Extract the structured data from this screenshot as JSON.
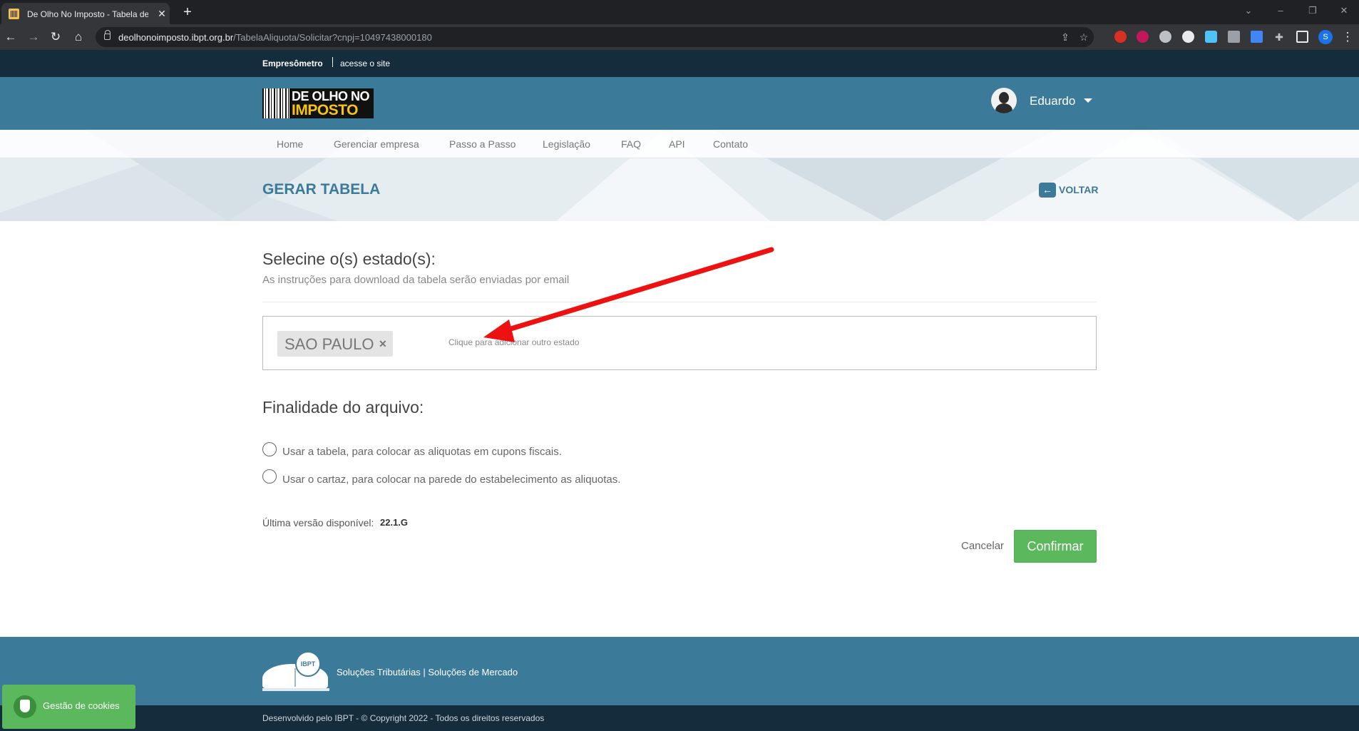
{
  "browser": {
    "tab_title": "De Olho No Imposto - Tabela de",
    "url_host": "deolhonoimposto.ibpt.org.br",
    "url_path": "/TabelaAliquota/Solicitar?cnpj=10497438000180",
    "profile_initial": "S"
  },
  "topstrip": {
    "brand": "Empresômetro",
    "link": "acesse o site"
  },
  "header": {
    "logo_line1": "DE OLHO NO",
    "logo_line2": "IMPOSTO",
    "user_name": "Eduardo"
  },
  "nav": {
    "items": [
      "Home",
      "Gerenciar empresa",
      "Passo a Passo",
      "Legislação",
      "FAQ",
      "API",
      "Contato"
    ]
  },
  "banner": {
    "title": "GERAR TABELA",
    "back_label": "VOLTAR"
  },
  "form": {
    "states_heading": "Selecine o(s) estado(s):",
    "states_subtitle": "As instruções para download da tabela serão enviadas por email",
    "selected_states": [
      "SAO PAULO"
    ],
    "select_placeholder": "Clique para adicionar outro estado",
    "purpose_heading": "Finalidade do arquivo:",
    "purpose_options": [
      {
        "label": "Usar a tabela, para colocar as aliquotas em cupons fiscais.",
        "checked": false
      },
      {
        "label": "Usar o cartaz, para colocar na parede do estabelecimento as aliquotas.",
        "checked": false
      }
    ],
    "version_label": "Última versão disponível:",
    "version_value": "22.1.G",
    "cancel_label": "Cancelar",
    "confirm_label": "Confirmar"
  },
  "footer": {
    "seal_text": "IBPT",
    "links_text": "Soluções Tributárias | Soluções de Mercado",
    "copyright": "Desenvolvido pelo IBPT - © Copyright 2022 - Todos os direitos reservados"
  },
  "cookie": {
    "label": "Gestão de cookies"
  },
  "colors": {
    "brand_blue": "#3b7a99",
    "dark_navy": "#142c3c",
    "confirm_green": "#5cb85c",
    "logo_yellow": "#f7c315",
    "annotation_red": "#ee1111"
  }
}
